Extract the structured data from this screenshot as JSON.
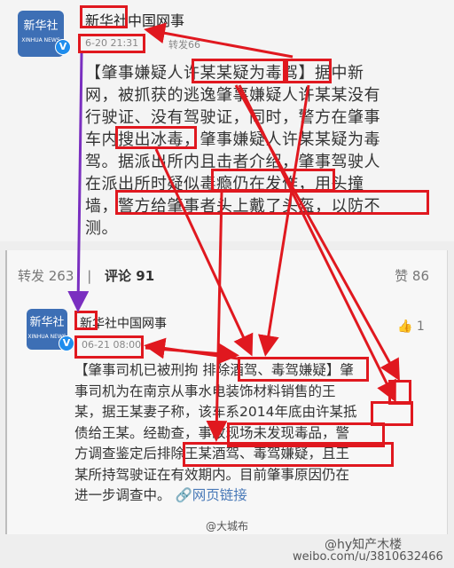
{
  "post1": {
    "author": "新华社中国网事",
    "time": "6-20 21:31",
    "repost_label": "转发66",
    "body_lines": [
      "【肇事嫌疑人许某某疑为毒驾】据中新",
      "网，被抓获的逃逸肇事嫌疑人许某某没有",
      "行驶证、没有驾驶证，同时，警方在肇事",
      "车内搜出冰毒，肇事嫌疑人许某某疑为毒",
      "驾。据派出所内且击者介绍，肇事驾驶人",
      "在派出所时疑似毒瘾仍在发作，用头撞",
      "墙，警方给肇事者头上戴了头盔，以防不",
      "测。"
    ],
    "avatar_text": "新华社",
    "avatar_sub": "XINHUA NEWS"
  },
  "tabs": {
    "repost": "转发 263",
    "comment": "评论 91",
    "like": "赞 86"
  },
  "post2": {
    "author": "新华社中国网事",
    "time": "06-21 08:00",
    "like_count": "1",
    "body_lines": [
      "【肇事司机已被刑拘 排除酒驾、毒驾嫌疑】肇",
      "事司机为在南京从事水电装饰材料销售的王",
      "某，据王某妻子称，该车系2014年底由许某抵",
      "债给王某。经勘查，事故现场未发现毒品，警",
      "方调查鉴定后排除王某酒驾、毒驾嫌疑，且王",
      "某所持驾驶证在有效期内。目前肇事原因仍在",
      "进一步调查中。"
    ],
    "link_text": "网页链接",
    "avatar_text": "新华社",
    "avatar_sub": "XINHUA NEWS"
  },
  "watermark": {
    "source": "@大城布",
    "weibo_user": "@hy知产木楼",
    "url": "weibo.com/u/3810632466"
  },
  "colors": {
    "highlight": "#e0181f",
    "arrow_blue": "#7a2fc0",
    "badge": "#1f8ded"
  }
}
